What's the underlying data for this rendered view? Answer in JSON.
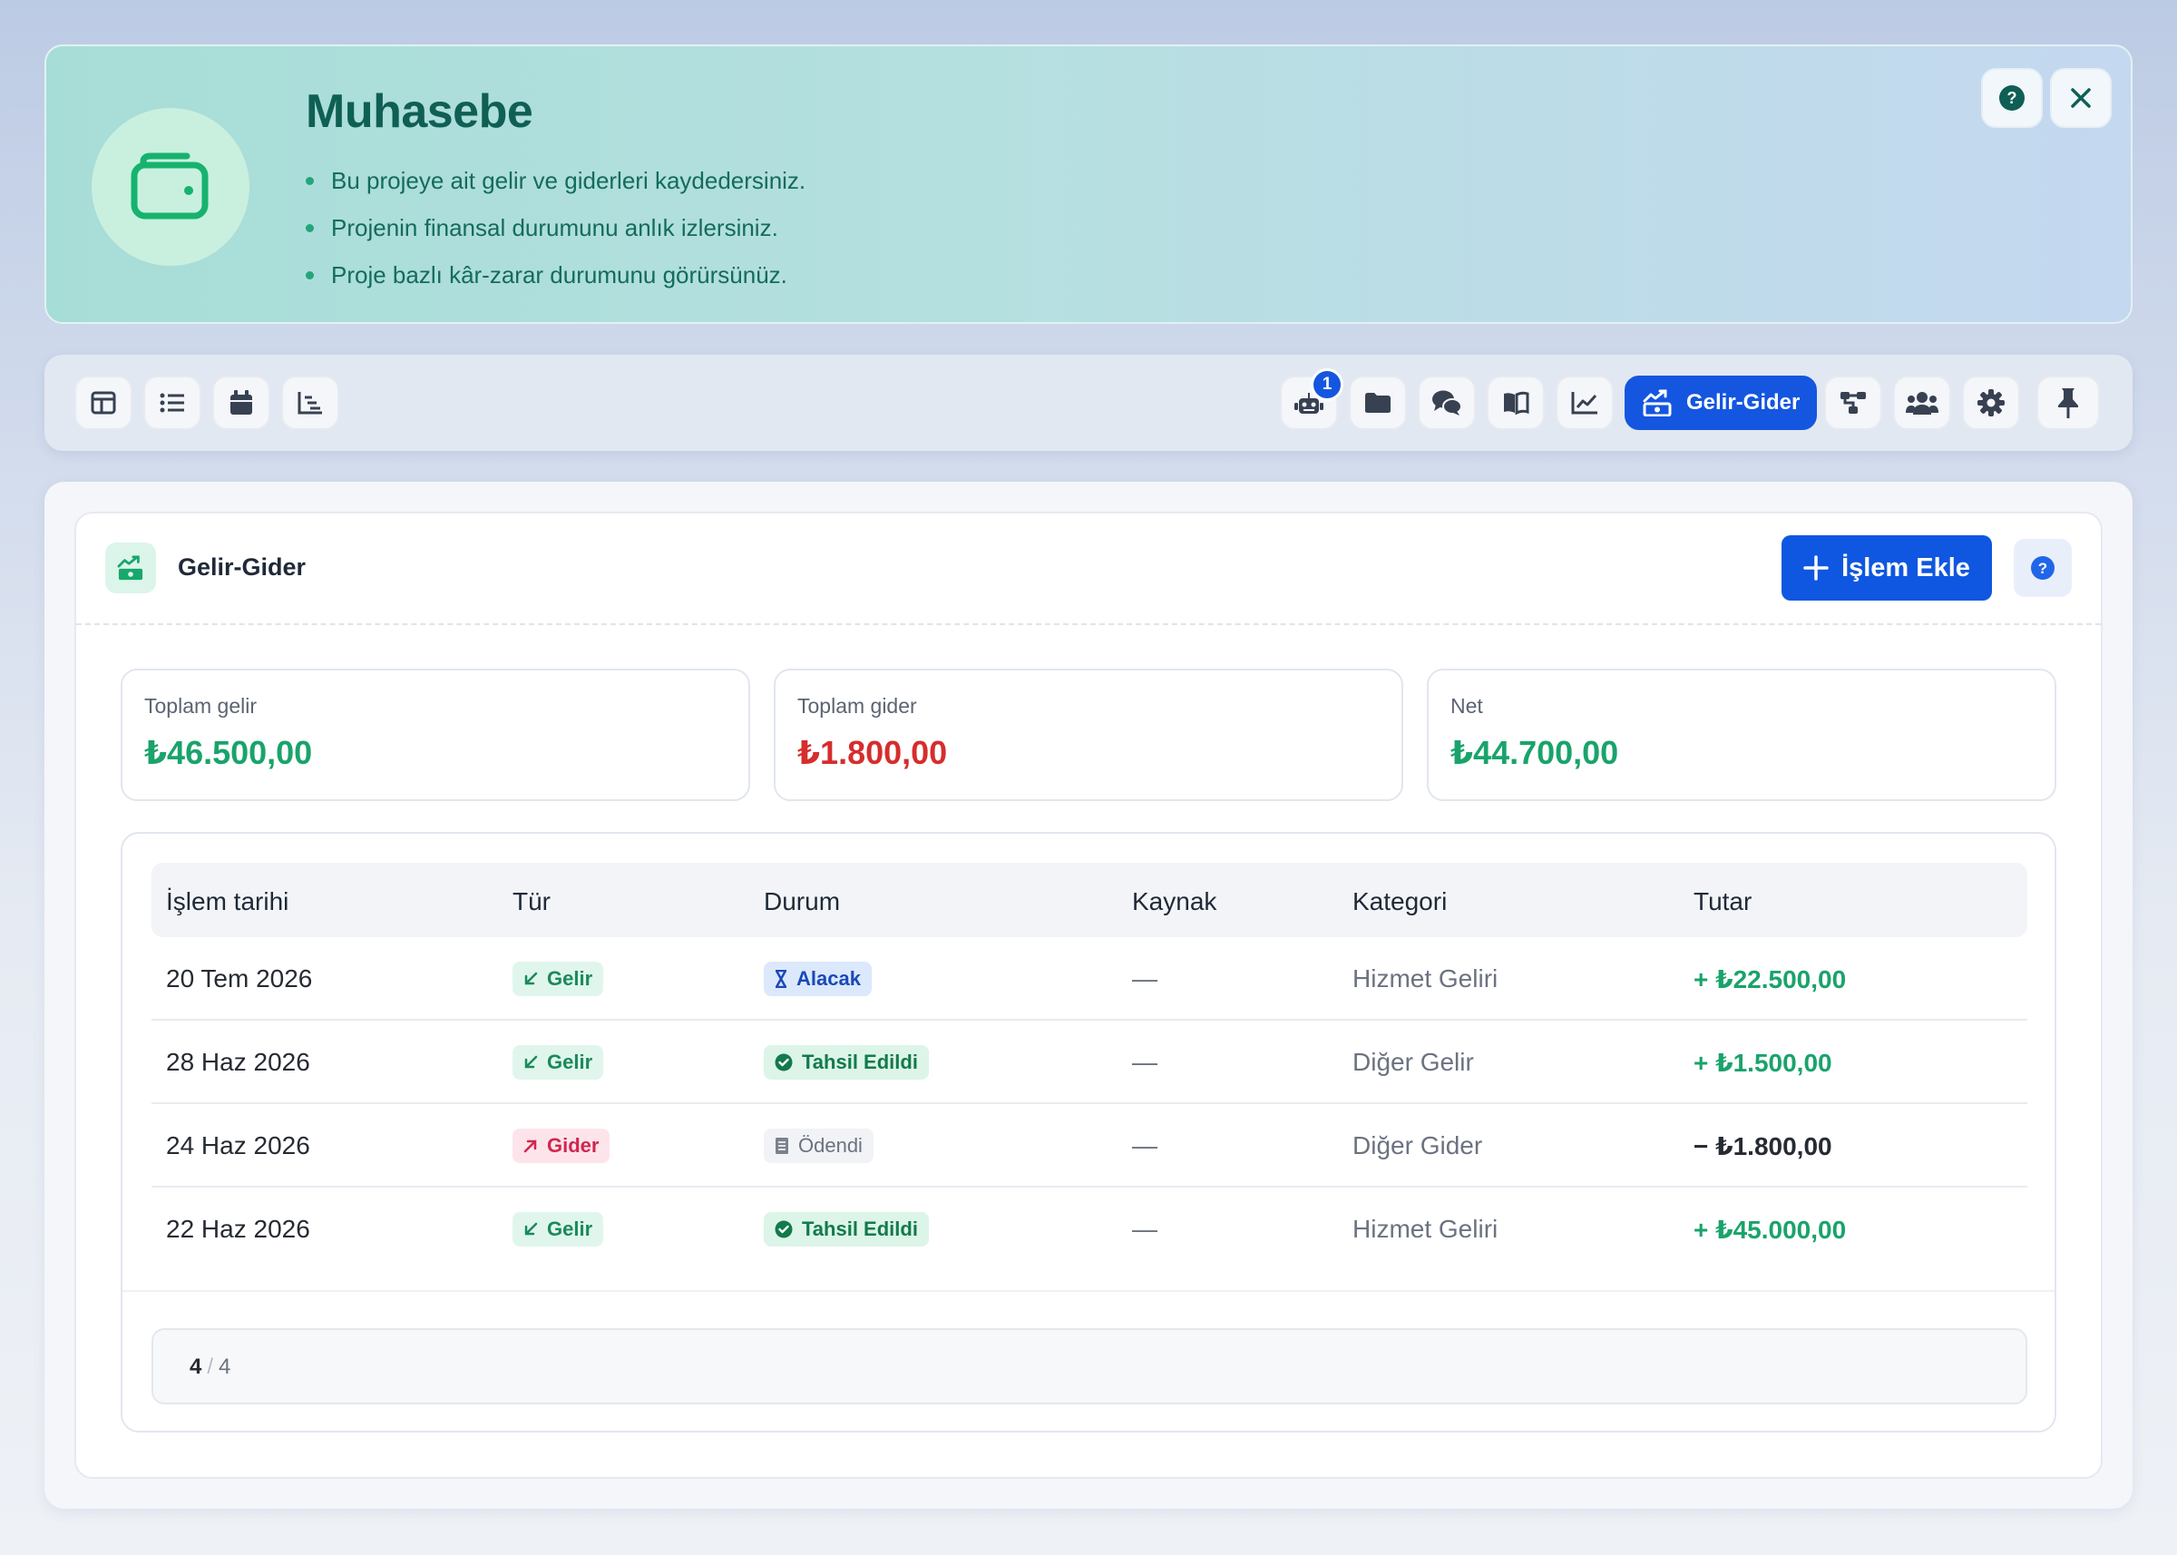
{
  "banner": {
    "title": "Muhasebe",
    "bullets": [
      "Bu projeye ait gelir ve giderleri kaydedersiniz.",
      "Projenin finansal durumunu anlık izlersiniz.",
      "Proje bazlı kâr-zarar durumunu görürsünüz."
    ],
    "icons": {
      "logo": "wallet-icon",
      "help": "help-icon",
      "close": "close-icon"
    }
  },
  "toolbar": {
    "left_icons": [
      "board-view-icon",
      "list-view-icon",
      "calendar-icon",
      "gantt-icon"
    ],
    "right_icons": [
      "robot-icon",
      "folder-icon",
      "chat-icon",
      "book-icon",
      "chart-line-icon",
      "gelir-gider-icon",
      "workflow-icon",
      "team-icon",
      "gear-icon",
      "pin-icon"
    ],
    "notification_count": "1",
    "active_label": "Gelir-Gider"
  },
  "panel": {
    "title": "Gelir-Gider",
    "add_button_label": "İşlem Ekle"
  },
  "stats": [
    {
      "label": "Toplam gelir",
      "value": "₺46.500,00",
      "color": "#1aa36b"
    },
    {
      "label": "Toplam gider",
      "value": "₺1.800,00",
      "color": "#d62d2d"
    },
    {
      "label": "Net",
      "value": "₺44.700,00",
      "color": "#1aa36b"
    }
  ],
  "table": {
    "columns": [
      "İşlem tarihi",
      "Tür",
      "Durum",
      "Kaynak",
      "Kategori",
      "Tutar"
    ],
    "rows": [
      {
        "date": "20 Tem 2026",
        "type": "Gelir",
        "status": "Alacak",
        "source": "—",
        "category": "Hizmet Geliri",
        "amount": "+ ₺22.500,00"
      },
      {
        "date": "28 Haz 2026",
        "type": "Gelir",
        "status": "Tahsil Edildi",
        "source": "—",
        "category": "Diğer Gelir",
        "amount": "+ ₺1.500,00"
      },
      {
        "date": "24 Haz 2026",
        "type": "Gider",
        "status": "Ödendi",
        "source": "—",
        "category": "Diğer Gider",
        "amount": "− ₺1.800,00"
      },
      {
        "date": "22 Haz 2026",
        "type": "Gelir",
        "status": "Tahsil Edildi",
        "source": "—",
        "category": "Hizmet Geliri",
        "amount": "+ ₺45.000,00"
      }
    ]
  },
  "pager": {
    "current": "4",
    "separator": "/",
    "total": "4"
  },
  "colors": {
    "accent": "#1456e0",
    "income": "#1aa36b",
    "expense": "#d62d2d",
    "brand_teal": "#0f5f55"
  }
}
